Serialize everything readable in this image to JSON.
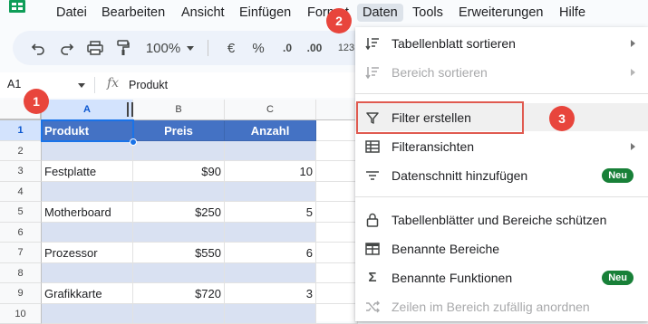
{
  "menubar": {
    "items": [
      "Datei",
      "Bearbeiten",
      "Ansicht",
      "Einfügen",
      "Format",
      "Daten",
      "Tools",
      "Erweiterungen",
      "Hilfe"
    ],
    "active": "Daten"
  },
  "toolbar": {
    "zoom": "100%",
    "currency": "€",
    "percent": "%",
    "decrease_decimals": ".0",
    "increase_decimals": ".00",
    "more_formats": "123"
  },
  "formula_bar": {
    "cell_ref": "A1",
    "fx": "fx",
    "value": "Produkt"
  },
  "grid": {
    "columns": [
      "A",
      "B",
      "C"
    ],
    "rows": [
      "1",
      "2",
      "3",
      "4",
      "5",
      "6",
      "7",
      "8",
      "9",
      "10"
    ],
    "cells": [
      [
        "Produkt",
        "Preis",
        "Anzahl"
      ],
      [
        "",
        "",
        ""
      ],
      [
        "Festplatte",
        "$90",
        "10"
      ],
      [
        "",
        "",
        ""
      ],
      [
        "Motherboard",
        "$250",
        "5"
      ],
      [
        "",
        "",
        ""
      ],
      [
        "Prozessor",
        "$550",
        "6"
      ],
      [
        "",
        "",
        ""
      ],
      [
        "Grafikkarte",
        "$720",
        "3"
      ],
      [
        "",
        "",
        ""
      ]
    ]
  },
  "menu": {
    "items": [
      {
        "label": "Tabellenblatt sortieren",
        "icon": "sort-icon"
      },
      {
        "label": "Bereich sortieren",
        "icon": "sort-range-icon"
      },
      {
        "label": "Filter erstellen",
        "icon": "filter-icon"
      },
      {
        "label": "Filteransichten",
        "icon": "filter-views-icon"
      },
      {
        "label": "Datenschnitt hinzufügen",
        "icon": "slicer-icon",
        "badge": "Neu"
      },
      {
        "label": "Tabellenblätter und Bereiche schützen",
        "icon": "lock-icon"
      },
      {
        "label": "Benannte Bereiche",
        "icon": "named-range-icon"
      },
      {
        "label": "Benannte Funktionen",
        "icon": "sigma-icon",
        "badge": "Neu"
      },
      {
        "label": "Zeilen im Bereich zufällig anordnen",
        "icon": "shuffle-icon"
      }
    ]
  },
  "markers": [
    "1",
    "2",
    "3"
  ],
  "colors": {
    "header_fill": "#4472c4",
    "band_fill": "#d9e1f2",
    "badge": "#188038",
    "marker": "#e8453c",
    "selection": "#1a73e8"
  }
}
